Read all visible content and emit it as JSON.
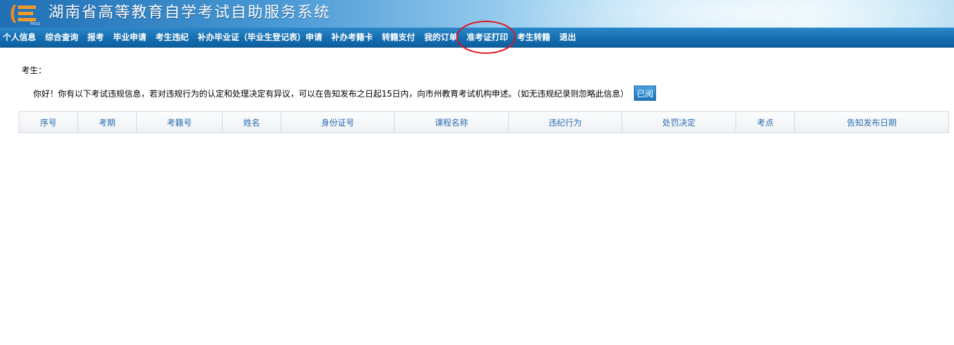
{
  "header": {
    "title": "湖南省高等教育自学考试自助服务系统",
    "logo_icon": "hnzk-logo-icon",
    "logo_text": "hnzz"
  },
  "nav": {
    "items": [
      "个人信息",
      "综合查询",
      "报考",
      "毕业申请",
      "考生违纪",
      "补办毕业证（毕业生登记表）申请",
      "补办考籍卡",
      "转籍支付",
      "我的订单",
      "准考证打印",
      "考生转籍",
      "退出"
    ],
    "highlighted": "准考证打印"
  },
  "content": {
    "examinee_label": "考生：",
    "notice": "你好！你有以下考试违规信息，若对违规行为的认定和处理决定有异议，可以在告知发布之日起15日内，向市州教育考试机构申述。（如无违规纪录则忽略此信息）",
    "read_button": "已阅"
  },
  "table": {
    "columns": [
      "序号",
      "考期",
      "考籍号",
      "姓名",
      "身份证号",
      "课程名称",
      "违纪行为",
      "处罚决定",
      "考点",
      "告知发布日期"
    ],
    "rows": []
  },
  "colors": {
    "nav_bg": "#1670b3",
    "header_text": "#ffffff",
    "table_header_text": "#2a6cb0",
    "highlight_circle": "#e0121b"
  }
}
